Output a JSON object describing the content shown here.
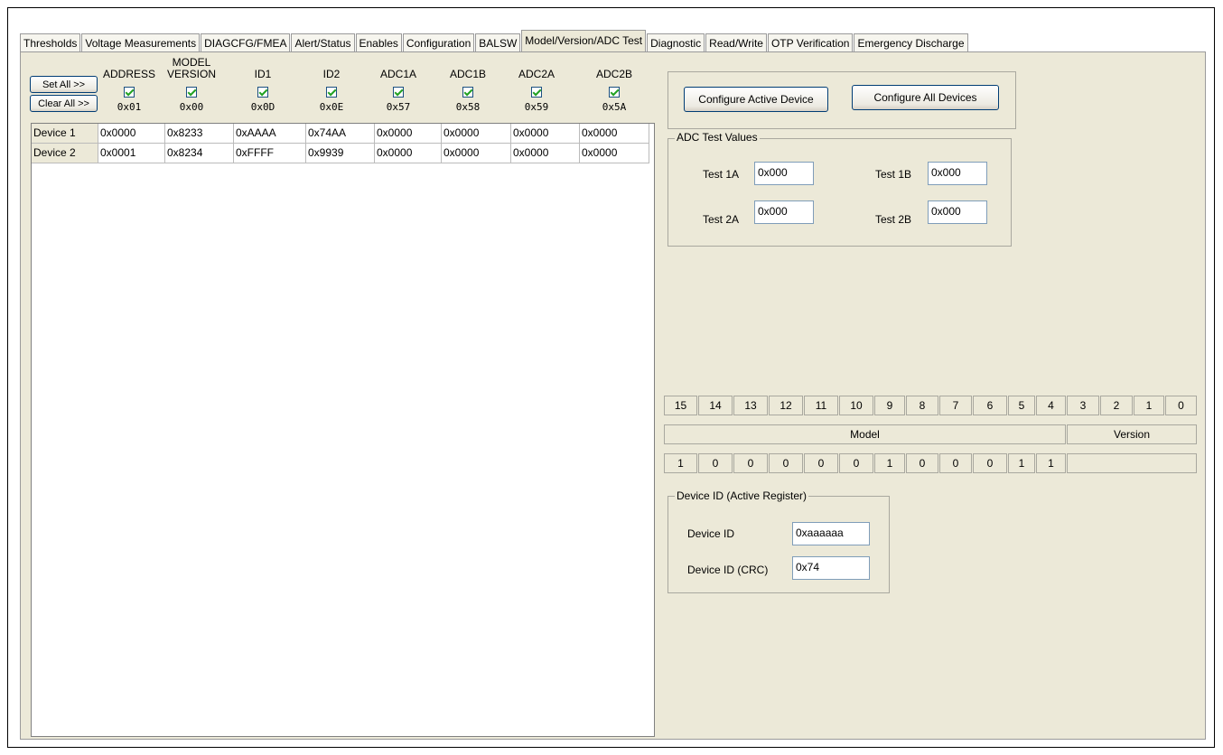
{
  "tabs": [
    "Thresholds",
    "Voltage Measurements",
    "DIAGCFG/FMEA",
    "Alert/Status",
    "Enables",
    "Configuration",
    "BALSW",
    "Model/Version/ADC Test",
    "Diagnostic",
    "Read/Write",
    "OTP Verification",
    "Emergency Discharge"
  ],
  "active_tab": "Model/Version/ADC Test",
  "buttons": {
    "set_all": "Set All >>",
    "clear_all": "Clear All >>",
    "configure_active": "Configure Active Device",
    "configure_all": "Configure All Devices"
  },
  "columns": [
    {
      "label": "ADDRESS",
      "address": "0x01",
      "checked": true
    },
    {
      "label": "MODEL VERSION",
      "address": "0x00",
      "checked": true
    },
    {
      "label": "ID1",
      "address": "0x0D",
      "checked": true
    },
    {
      "label": "ID2",
      "address": "0x0E",
      "checked": true
    },
    {
      "label": "ADC1A",
      "address": "0x57",
      "checked": true
    },
    {
      "label": "ADC1B",
      "address": "0x58",
      "checked": true
    },
    {
      "label": "ADC2A",
      "address": "0x59",
      "checked": true
    },
    {
      "label": "ADC2B",
      "address": "0x5A",
      "checked": true
    }
  ],
  "rows": [
    {
      "device": "Device 1",
      "values": [
        "0x0000",
        "0x8233",
        "0xAAAA",
        "0x74AA",
        "0x0000",
        "0x0000",
        "0x0000",
        "0x0000"
      ]
    },
    {
      "device": "Device 2",
      "values": [
        "0x0001",
        "0x8234",
        "0xFFFF",
        "0x9939",
        "0x0000",
        "0x0000",
        "0x0000",
        "0x0000"
      ]
    }
  ],
  "adc_test": {
    "legend": "ADC Test Values",
    "test_1a_label": "Test 1A",
    "test_1a_value": "0x000",
    "test_1b_label": "Test 1B",
    "test_1b_value": "0x000",
    "test_2a_label": "Test 2A",
    "test_2a_value": "0x000",
    "test_2b_label": "Test 2B",
    "test_2b_value": "0x000"
  },
  "bits": {
    "headers": [
      "15",
      "14",
      "13",
      "12",
      "11",
      "10",
      "9",
      "8",
      "7",
      "6",
      "5",
      "4",
      "3",
      "2",
      "1",
      "0"
    ],
    "model_label": "Model",
    "version_label": "Version",
    "model_values": [
      "1",
      "0",
      "0",
      "0",
      "0",
      "0",
      "1",
      "0",
      "0",
      "0",
      "1",
      "1"
    ],
    "version_values": ""
  },
  "device_id": {
    "legend": "Device ID (Active Register)",
    "device_id_label": "Device ID",
    "device_id_value": "0xaaaaaa",
    "crc_label": "Device ID (CRC)",
    "crc_value": "0x74"
  }
}
